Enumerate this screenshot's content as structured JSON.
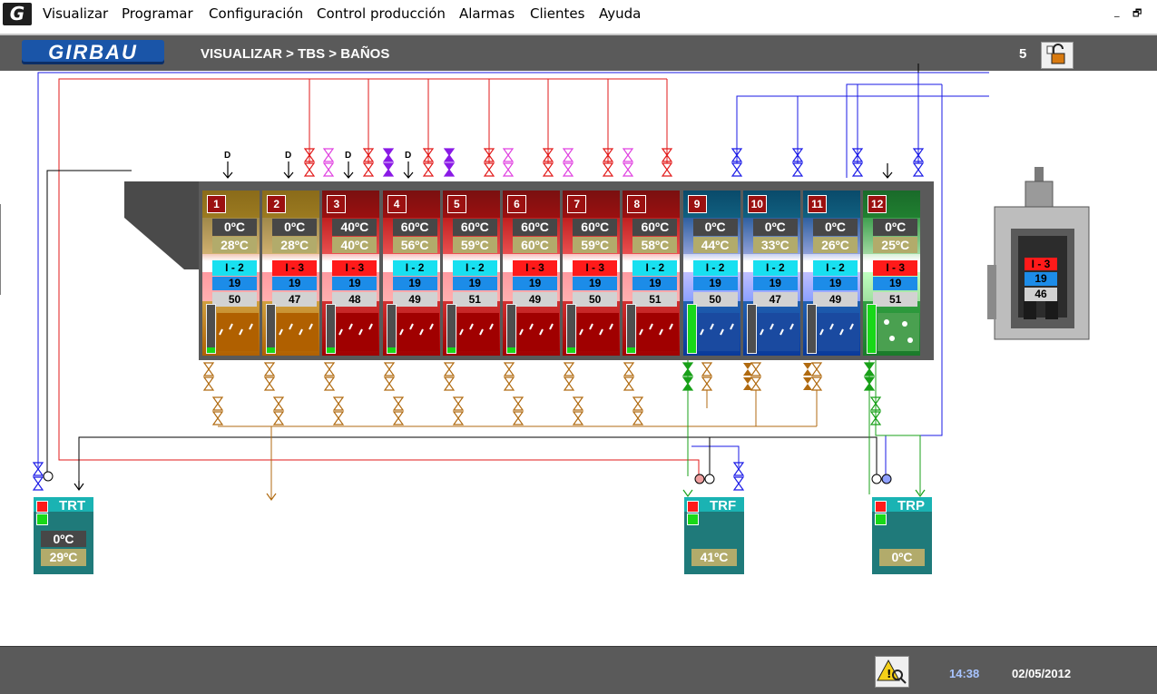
{
  "menu": [
    "Visualizar",
    "Programar",
    "Configuración",
    "Control producción",
    "Alarmas",
    "Clientes",
    "Ayuda"
  ],
  "window_controls": {
    "minimize": "_",
    "restore": "🗗"
  },
  "header": {
    "brand": "GIRBAU",
    "breadcrumb": "VISUALIZAR > TBS > BAÑOS",
    "page_number": "5"
  },
  "compartments": [
    {
      "num": "1",
      "set": "0ºC",
      "actual": "28ºC",
      "program": "I - 2",
      "bath": "19",
      "level": "50",
      "type": "pre",
      "bar_fill": 0.12
    },
    {
      "num": "2",
      "set": "0ºC",
      "actual": "28ºC",
      "program": "I - 3",
      "bath": "19",
      "level": "47",
      "type": "pre",
      "bar_fill": 0.12
    },
    {
      "num": "3",
      "set": "40ºC",
      "actual": "40ºC",
      "program": "I - 3",
      "bath": "19",
      "level": "48",
      "type": "hot",
      "bar_fill": 0.12
    },
    {
      "num": "4",
      "set": "60ºC",
      "actual": "56ºC",
      "program": "I - 2",
      "bath": "19",
      "level": "49",
      "type": "hot",
      "bar_fill": 0.12
    },
    {
      "num": "5",
      "set": "60ºC",
      "actual": "59ºC",
      "program": "I - 2",
      "bath": "19",
      "level": "51",
      "type": "hot",
      "bar_fill": 0.12
    },
    {
      "num": "6",
      "set": "60ºC",
      "actual": "60ºC",
      "program": "I - 3",
      "bath": "19",
      "level": "49",
      "type": "hot",
      "bar_fill": 0.12
    },
    {
      "num": "7",
      "set": "60ºC",
      "actual": "59ºC",
      "program": "I - 3",
      "bath": "19",
      "level": "50",
      "type": "hot",
      "bar_fill": 0.12
    },
    {
      "num": "8",
      "set": "60ºC",
      "actual": "58ºC",
      "program": "I - 2",
      "bath": "19",
      "level": "51",
      "type": "hot",
      "bar_fill": 0.12
    },
    {
      "num": "9",
      "set": "0ºC",
      "actual": "44ºC",
      "program": "I - 2",
      "bath": "19",
      "level": "50",
      "type": "rinse",
      "bar_fill": 1.0
    },
    {
      "num": "10",
      "set": "0ºC",
      "actual": "33ºC",
      "program": "I - 2",
      "bath": "19",
      "level": "47",
      "type": "rinse",
      "bar_fill": 0
    },
    {
      "num": "11",
      "set": "0ºC",
      "actual": "26ºC",
      "program": "I - 2",
      "bath": "19",
      "level": "49",
      "type": "rinse",
      "bar_fill": 0
    },
    {
      "num": "12",
      "set": "0ºC",
      "actual": "25ºC",
      "program": "I - 3",
      "bath": "19",
      "level": "51",
      "type": "final",
      "bar_fill": 1.0
    }
  ],
  "dosing_labels": [
    "D",
    "D",
    "D",
    "D"
  ],
  "tanks": [
    {
      "name": "TRT",
      "val1": "0ºC",
      "val2": "29ºC"
    },
    {
      "name": "TRF",
      "val1": "",
      "val2": "41ºC"
    },
    {
      "name": "TRP",
      "val1": "",
      "val2": "0ºC"
    }
  ],
  "dryer": {
    "program": "I - 3",
    "bath": "19",
    "level": "46"
  },
  "footer": {
    "time": "14:38",
    "date": "02/05/2012"
  },
  "colors": {
    "header": "#5a5a5a",
    "hot_water": "#e21a1a",
    "cold_water": "#1a1ae6",
    "drain": "#b06a10",
    "recirc": "#18a018",
    "detergent": "#e040e0"
  },
  "icons": {
    "alarm": "alarm-search-icon",
    "lock": "lock-icon"
  }
}
